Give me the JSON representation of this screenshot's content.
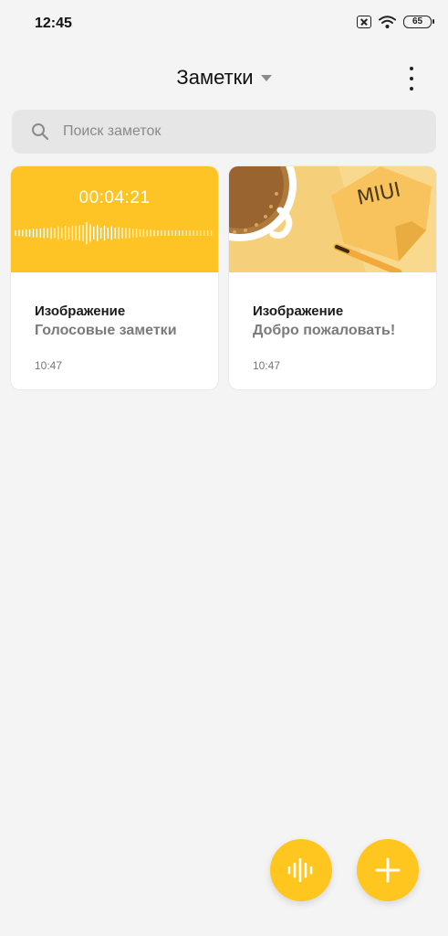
{
  "status": {
    "time": "12:45",
    "battery": "65"
  },
  "header": {
    "title": "Заметки"
  },
  "search": {
    "placeholder": "Поиск заметок"
  },
  "notes": [
    {
      "duration": "00:04:21",
      "title": "Изображение",
      "subtitle": "Голосовые заметки",
      "time": "10:47"
    },
    {
      "image_text": "MIUI",
      "title": "Изображение",
      "subtitle": "Добро пожаловать!",
      "time": "10:47"
    }
  ],
  "colors": {
    "accent": "#fec61e",
    "voice_card": "#fec324",
    "background": "#f4f4f4"
  }
}
